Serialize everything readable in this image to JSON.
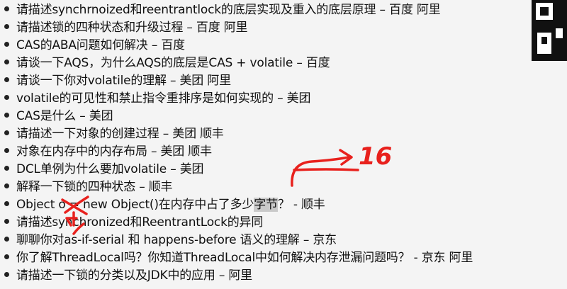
{
  "items": [
    {
      "text": "请描述synchrnoized和reentrantlock的底层实现及重入的底层原理 – 百度 阿里"
    },
    {
      "text": "请描述锁的四种状态和升级过程 – 百度 阿里"
    },
    {
      "text": "CAS的ABA问题如何解决 – 百度"
    },
    {
      "text": "请谈一下AQS，为什么AQS的底层是CAS + volatile – 百度"
    },
    {
      "text": "请谈一下你对volatile的理解 – 美团 阿里"
    },
    {
      "text": "volatile的可见性和禁止指令重排序是如何实现的 – 美团"
    },
    {
      "text": "CAS是什么 – 美团"
    },
    {
      "text": "请描述一下对象的创建过程 – 美团 顺丰"
    },
    {
      "text": "对象在内存中的内存布局 – 美团 顺丰"
    },
    {
      "text": "DCL单例为什么要加volatile – 美团"
    },
    {
      "text": "解释一下锁的四种状态 – 顺丰"
    },
    {
      "text_before": "Object o = new Object()在内存中占了多少",
      "highlight": "字节",
      "text_after": "？ - 顺丰"
    },
    {
      "text": "请描述synchronized和ReentrantLock的异同"
    },
    {
      "text": "聊聊你对as-if-serial 和 happens-before 语义的理解 – 京东"
    },
    {
      "text": "你了解ThreadLocal吗？你知道ThreadLocal中如何解决内存泄漏问题吗？ - 京东 阿里"
    },
    {
      "text": "请描述一下锁的分类以及JDK中的应用 – 阿里"
    }
  ],
  "annotation": {
    "handwritten_text": "16",
    "color": "#e8211d"
  },
  "colors": {
    "background": "#f4f4f4",
    "text": "#111111",
    "highlight": "#c9c9c9",
    "annotation_red": "#e8211d"
  }
}
